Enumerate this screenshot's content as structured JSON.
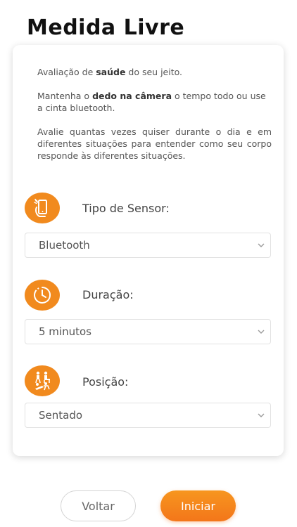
{
  "page": {
    "title": "Medida Livre"
  },
  "intro": {
    "p1_before": "Avaliação de ",
    "p1_bold": "saúde",
    "p1_after": " do seu jeito.",
    "p2_before": "Mantenha o ",
    "p2_bold": "dedo na câmera",
    "p2_after": " o tempo todo ou use a cinta bluetooth.",
    "p3": "Avalie quantas vezes quiser durante o dia e em diferentes situações para entender como seu corpo responde às diferentes situações."
  },
  "sections": {
    "sensor": {
      "label": "Tipo de Sensor:",
      "value": "Bluetooth",
      "icon": "phone-hand-icon"
    },
    "duration": {
      "label": "Duração:",
      "value": "5 minutos",
      "icon": "clock-icon"
    },
    "position": {
      "label": "Posição:",
      "value": "Sentado",
      "icon": "body-positions-icon"
    }
  },
  "buttons": {
    "back": "Voltar",
    "start": "Iniciar"
  },
  "colors": {
    "accent": "#f18a1e",
    "start_gradient_top": "#f7961f",
    "start_gradient_bottom": "#f3761a"
  }
}
